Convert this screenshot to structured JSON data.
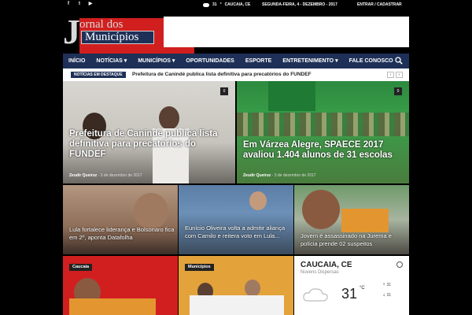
{
  "topbar": {
    "social": [
      "facebook-icon",
      "twitter-icon",
      "youtube-icon"
    ],
    "weather_temp": "31",
    "weather_unit": "°",
    "weather_city": "CAUCAIA, CE",
    "date": "SEGUNDA-FEIRA, 4 - DEZEMBRO - 2017",
    "login": "ENTRAR / CADASTRAR"
  },
  "logo": {
    "line1": "ornal dos",
    "line2": "Municípios",
    "initial": "J"
  },
  "nav": {
    "items": [
      "INÍCIO",
      "NOTÍCIAS",
      "MUNICÍPIOS",
      "OPORTUNIDADES",
      "ESPORTE",
      "ENTRETENIMENTO",
      "FALE CONOSCO"
    ],
    "dropdown_flags": [
      false,
      true,
      true,
      false,
      false,
      true,
      false
    ]
  },
  "ticker": {
    "label": "NOTÍCIAS EM DESTAQUE",
    "text": "Prefeitura de Canindé publica lista definitiva para precatórios do FUNDEF",
    "prev": "‹",
    "next": "›"
  },
  "featured": [
    {
      "title": "Prefeitura de Canindé publica lista definitiva para precatórios do FUNDEF",
      "author": "Zeudir Queiroz",
      "date": "3 de dezembro de 2017",
      "comments": "0"
    },
    {
      "title": "Em Várzea Alegre, SPAECE 2017 avaliou 1.404 alunos de 31 escolas",
      "author": "Zeudir Queiroz",
      "date": "3 de dezembro de 2017",
      "comments": "0"
    }
  ],
  "small_cards": [
    {
      "title": "Lula fortalece liderança e Bolsonaro fica em 2º, aponta Datafolha"
    },
    {
      "title": "Eunício Oliveira volta a admitir aliança com Camilo e reitera voto em Lula..."
    },
    {
      "title": "Jovem é assassinado na Jurema e polícia prende 02 suspeitos"
    }
  ],
  "lower": [
    {
      "category": "Caucaia"
    },
    {
      "category": "Municípios"
    }
  ],
  "weather_widget": {
    "city": "CAUCAIA, CE",
    "desc": "Nuvens Dispersas",
    "temp": "31",
    "unit": "°C",
    "high": "31",
    "low": "31"
  },
  "colors": {
    "nav": "#1e3057",
    "caucaia": "#d11f1f",
    "municipios": "#e3a23a"
  }
}
